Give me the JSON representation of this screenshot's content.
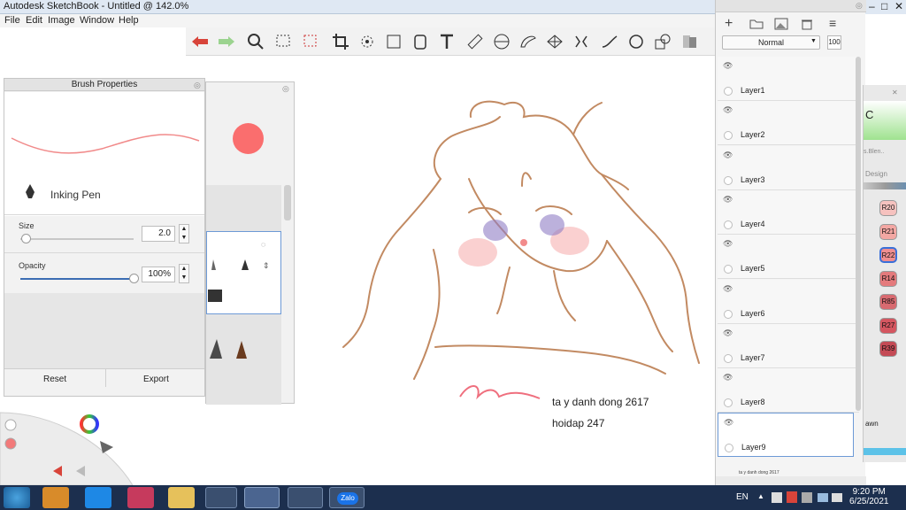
{
  "window": {
    "title": "Autodesk SketchBook - Untitled @ 142.0%"
  },
  "menu": [
    "File",
    "Edit",
    "Image",
    "Window",
    "Help"
  ],
  "toolbar": {
    "icons": [
      "undo-icon",
      "redo-icon",
      "zoom-icon",
      "select-icon",
      "lasso-icon",
      "crop-icon",
      "transform-icon",
      "distort-icon",
      "fill-icon",
      "text-icon",
      "ruler-icon",
      "ellipse-guide-icon",
      "french-curve-icon",
      "perspective-icon",
      "symmetry-icon",
      "line-icon",
      "circle-icon",
      "shapes-icon",
      "copic-icon"
    ]
  },
  "brush_properties": {
    "title": "Brush Properties",
    "brush_name": "Inking Pen",
    "size_label": "Size",
    "size_value": "2.0",
    "size_level": 0.05,
    "opacity_label": "Opacity",
    "opacity_value": "100%",
    "opacity_level": 1.0,
    "reset_label": "Reset",
    "export_label": "Export"
  },
  "layers": {
    "blend_mode": "Normal",
    "opacity": "100",
    "items": [
      {
        "name": "Layer1"
      },
      {
        "name": "Layer2"
      },
      {
        "name": "Layer3"
      },
      {
        "name": "Layer4"
      },
      {
        "name": "Layer5"
      },
      {
        "name": "Layer6"
      },
      {
        "name": "Layer7"
      },
      {
        "name": "Layer8"
      },
      {
        "name": "Layer9"
      }
    ],
    "bottom_partial": "ta y danh dong 2617"
  },
  "copic": {
    "partial_label": "Design",
    "partial_text": "s.Blen..",
    "partial_lawn": "awn",
    "swatches": [
      "R20",
      "R21",
      "R22",
      "R14",
      "R85",
      "R27",
      "R39"
    ],
    "swatch_colors": [
      "#f6c2bf",
      "#f3a7a3",
      "#ef8e90",
      "#e47a7c",
      "#d86a70",
      "#d55660",
      "#c44a55"
    ]
  },
  "canvas": {
    "signature_name": "ta y danh dong 2617",
    "signature_id": "hoidap 247"
  },
  "taskbar": {
    "lang": "EN",
    "time": "9:20 PM",
    "date": "6/25/2021",
    "zalo_label": "Zalo"
  }
}
